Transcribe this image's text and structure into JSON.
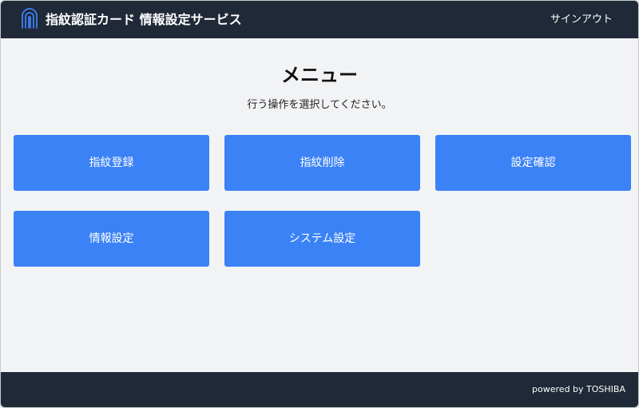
{
  "header": {
    "app_title": "指紋認証カード 情報設定サービス",
    "logo_icon": "fingerprint-icon",
    "signout_label": "サインアウト",
    "background_color": "#1f2937"
  },
  "main": {
    "title": "メニュー",
    "subtitle": "行う操作を選択してください。",
    "buttons": [
      {
        "label": "指紋登録"
      },
      {
        "label": "指紋削除"
      },
      {
        "label": "設定確認"
      },
      {
        "label": "情報設定"
      },
      {
        "label": "システム設定"
      }
    ],
    "button_color": "#3b82f6"
  },
  "footer": {
    "powered_by": "powered by TOSHIBA"
  }
}
